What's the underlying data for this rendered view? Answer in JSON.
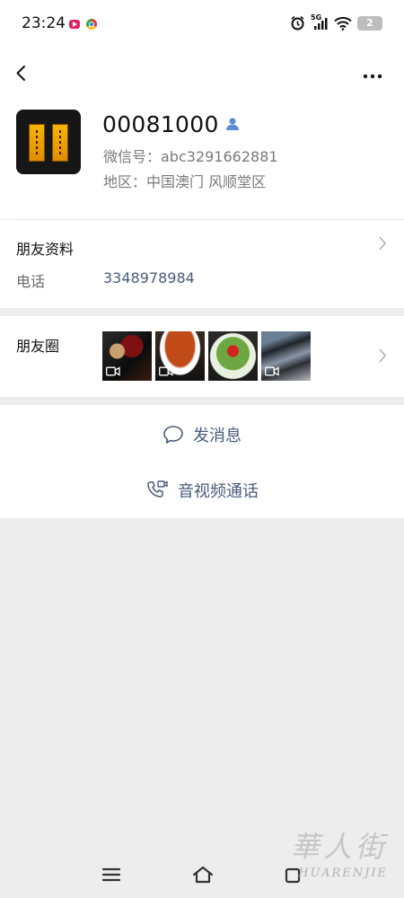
{
  "status_bar": {
    "time": "23:24",
    "network": "5G",
    "battery": "2"
  },
  "profile": {
    "name": "00081000",
    "wechat_id": "微信号：abc3291662881",
    "region": "地区：中国澳门  风顺堂区"
  },
  "friend_info": {
    "title": "朋友资料",
    "phone_label": "电话",
    "phone_value": "3348978984"
  },
  "moments": {
    "title": "朋友圈",
    "thumbnails": [
      "video",
      "video",
      "photo",
      "video"
    ]
  },
  "actions": {
    "send_message": "发消息",
    "video_call": "音视频通话"
  },
  "watermark": {
    "glyph": "華人街",
    "text": "HUARENJIE"
  },
  "colors": {
    "link": "#4a5b7c",
    "background": "#ededed",
    "accent_icon": "#5b8dd6"
  }
}
